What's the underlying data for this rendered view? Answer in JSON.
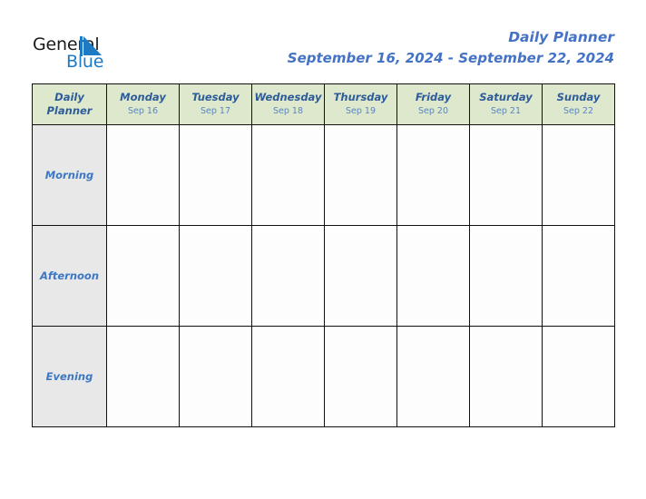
{
  "brand": {
    "word_one": "General",
    "word_two": "Blue",
    "triangle_icon": "triangle-icon",
    "dark_color": "#1a1a1a",
    "blue_color": "#1f7ac4"
  },
  "header": {
    "title": "Daily Planner",
    "subtitle": "September 16, 2024 - September 22, 2024",
    "accent_color": "#4472c4"
  },
  "table": {
    "corner": {
      "line_one": "Daily",
      "line_two": "Planner"
    },
    "header_background": "#dde8cc",
    "label_background": "#e8e8e8",
    "cell_background": "#fdfdfd",
    "border_color": "#111111",
    "days": [
      {
        "name": "Monday",
        "date": "Sep 16"
      },
      {
        "name": "Tuesday",
        "date": "Sep 17"
      },
      {
        "name": "Wednesday",
        "date": "Sep 18"
      },
      {
        "name": "Thursday",
        "date": "Sep 19"
      },
      {
        "name": "Friday",
        "date": "Sep 20"
      },
      {
        "name": "Saturday",
        "date": "Sep 21"
      },
      {
        "name": "Sunday",
        "date": "Sep 22"
      }
    ],
    "slots": [
      {
        "label": "Morning",
        "entries": [
          "",
          "",
          "",
          "",
          "",
          "",
          ""
        ]
      },
      {
        "label": "Afternoon",
        "entries": [
          "",
          "",
          "",
          "",
          "",
          "",
          ""
        ]
      },
      {
        "label": "Evening",
        "entries": [
          "",
          "",
          "",
          "",
          "",
          "",
          ""
        ]
      }
    ]
  }
}
